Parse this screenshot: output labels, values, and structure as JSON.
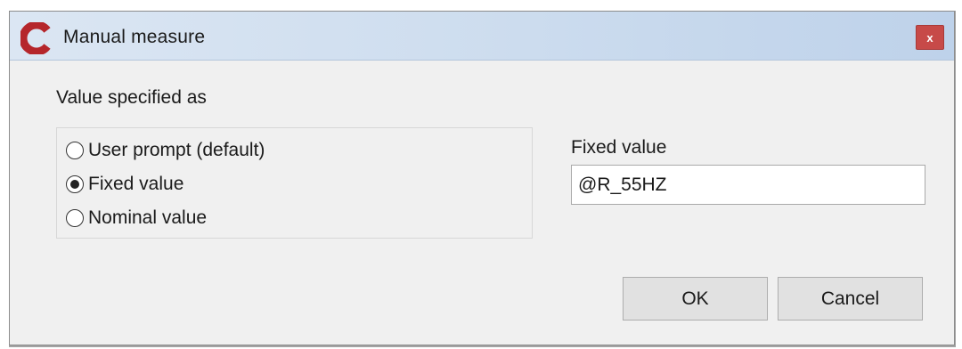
{
  "window": {
    "title": "Manual measure",
    "close_label": "x"
  },
  "colors": {
    "close_button": "#c74a48",
    "logo": "#b5262b",
    "titlebar_gradient_end": "#bed2ea"
  },
  "icons": {
    "app_logo": "app-logo-icon",
    "close": "close-icon"
  },
  "value_section": {
    "label": "Value specified as",
    "options": [
      {
        "label": "User prompt (default)",
        "checked": false
      },
      {
        "label": "Fixed value",
        "checked": true
      },
      {
        "label": "Nominal value",
        "checked": false
      }
    ]
  },
  "fixed_value": {
    "label": "Fixed value",
    "value": "@R_55HZ"
  },
  "buttons": {
    "ok_label": "OK",
    "cancel_label": "Cancel"
  }
}
